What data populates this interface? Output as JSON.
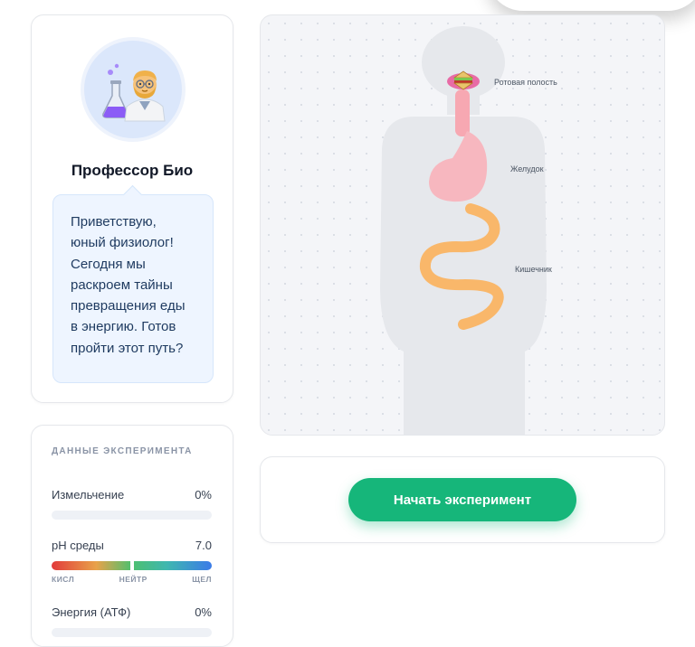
{
  "professor": {
    "avatar_icon": "scientist-icon",
    "name": "Профессор Био",
    "speech_lines": [
      "Приветствую,",
      "юный физиолог!",
      "Сегодня мы",
      "раскроем тайны",
      "превращения еды",
      "в энергию. Готов",
      "пройти этот путь?"
    ]
  },
  "experiment": {
    "title": "ДАННЫЕ ЭКСПЕРИМЕНТА",
    "grinding": {
      "label": "Измельчение",
      "value": "0%",
      "fraction": 0
    },
    "ph": {
      "label": "pH среды",
      "value": "7.0",
      "marker_fraction": 0.5,
      "scale_labels": {
        "acid": "КИСЛ",
        "neutral": "НЕЙТР",
        "alkaline": "ЩЕЛ"
      }
    },
    "energy": {
      "label": "Энергия (АТФ)",
      "value": "0%",
      "fraction": 0
    }
  },
  "body_map": {
    "organs": {
      "mouth": "Ротовая полость",
      "stomach": "Желудок",
      "intestine": "Кишечник"
    },
    "food_icon": "sandwich-icon"
  },
  "actions": {
    "start_label": "Начать эксперимент"
  },
  "colors": {
    "accent": "#16b67a",
    "speech_bg": "#eef5ff",
    "esophagus": "#f7a8b2",
    "intestine": "#f9b76a",
    "mouth": "#e86ba6"
  }
}
